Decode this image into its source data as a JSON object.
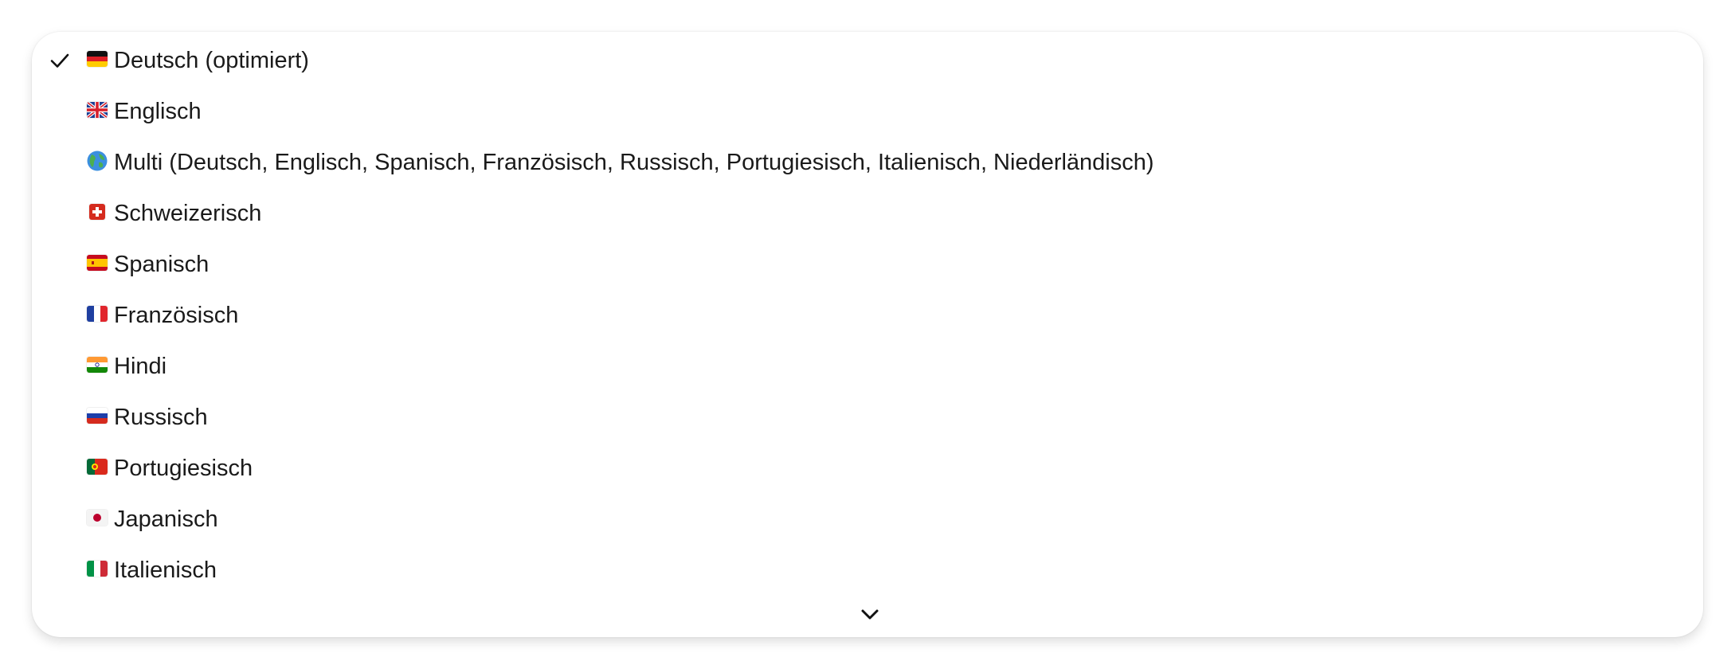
{
  "language_menu": {
    "selected_index": 0,
    "items": [
      {
        "label": "Deutsch (optimiert)",
        "icon": "flag-germany-icon"
      },
      {
        "label": "Englisch",
        "icon": "flag-united-kingdom-icon"
      },
      {
        "label": "Multi (Deutsch, Englisch, Spanisch, Französisch, Russisch, Portugiesisch, Italienisch, Niederländisch)",
        "icon": "globe-icon"
      },
      {
        "label": "Schweizerisch",
        "icon": "flag-switzerland-icon"
      },
      {
        "label": "Spanisch",
        "icon": "flag-spain-icon"
      },
      {
        "label": "Französisch",
        "icon": "flag-france-icon"
      },
      {
        "label": "Hindi",
        "icon": "flag-india-icon"
      },
      {
        "label": "Russisch",
        "icon": "flag-russia-icon"
      },
      {
        "label": "Portugiesisch",
        "icon": "flag-portugal-icon"
      },
      {
        "label": "Japanisch",
        "icon": "flag-japan-icon"
      },
      {
        "label": "Italienisch",
        "icon": "flag-italy-icon"
      }
    ],
    "scroll_indicator": "chevron-down-icon"
  }
}
